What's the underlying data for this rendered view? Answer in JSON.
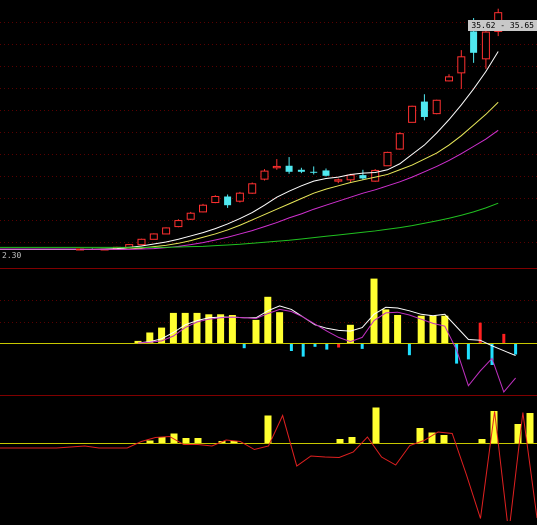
{
  "price_tag": "35.62 - 35.65",
  "low_label": "2.30",
  "colors": {
    "background": "#000000",
    "panel_border": "#800000",
    "grid_dot": "#5a0000",
    "up_candle": "#ff3030",
    "down_candle": "#50e8f0",
    "ma_short": "#ffffff",
    "ma_mid": "#e8e85a",
    "ma_long": "#d030d0",
    "ma_longest": "#20c020",
    "volume_yellow": "#ffff30",
    "volume_red": "#ff2020",
    "volume_cyan": "#20e0ff",
    "macd_line": "#ffffff",
    "signal_line": "#c030c0",
    "zero_line": "#c8c800",
    "indicator_red": "#e02020"
  },
  "chart_data": [
    {
      "type": "candlestick",
      "title": "",
      "candles": [
        {
          "o": 3.0,
          "h": 3.1,
          "l": 2.9,
          "c": 3.05,
          "dir": "up"
        },
        {
          "o": 3.05,
          "h": 3.15,
          "l": 2.95,
          "c": 3.0,
          "dir": "down"
        },
        {
          "o": 3.0,
          "h": 3.1,
          "l": 2.95,
          "c": 3.05,
          "dir": "up"
        },
        {
          "o": 3.1,
          "h": 3.4,
          "l": 3.05,
          "c": 3.3,
          "dir": "up"
        },
        {
          "o": 3.3,
          "h": 3.8,
          "l": 3.2,
          "c": 3.7,
          "dir": "up"
        },
        {
          "o": 3.7,
          "h": 4.6,
          "l": 3.7,
          "c": 4.5,
          "dir": "up"
        },
        {
          "o": 4.5,
          "h": 5.4,
          "l": 4.5,
          "c": 5.3,
          "dir": "up"
        },
        {
          "o": 5.3,
          "h": 6.3,
          "l": 5.3,
          "c": 6.2,
          "dir": "up"
        },
        {
          "o": 6.4,
          "h": 7.5,
          "l": 6.3,
          "c": 7.3,
          "dir": "up"
        },
        {
          "o": 7.5,
          "h": 8.6,
          "l": 7.4,
          "c": 8.4,
          "dir": "up"
        },
        {
          "o": 8.6,
          "h": 9.8,
          "l": 8.5,
          "c": 9.6,
          "dir": "up"
        },
        {
          "o": 10.0,
          "h": 11.1,
          "l": 9.9,
          "c": 10.9,
          "dir": "up"
        },
        {
          "o": 10.9,
          "h": 11.2,
          "l": 9.2,
          "c": 9.6,
          "dir": "down"
        },
        {
          "o": 10.2,
          "h": 11.6,
          "l": 10.0,
          "c": 11.4,
          "dir": "up"
        },
        {
          "o": 11.4,
          "h": 13.0,
          "l": 11.3,
          "c": 12.8,
          "dir": "up"
        },
        {
          "o": 13.5,
          "h": 15.0,
          "l": 13.3,
          "c": 14.7,
          "dir": "up"
        },
        {
          "o": 15.2,
          "h": 16.5,
          "l": 14.9,
          "c": 15.4,
          "dir": "up"
        },
        {
          "o": 15.5,
          "h": 16.8,
          "l": 14.3,
          "c": 14.6,
          "dir": "down"
        },
        {
          "o": 14.9,
          "h": 15.2,
          "l": 14.4,
          "c": 14.6,
          "dir": "down"
        },
        {
          "o": 14.6,
          "h": 15.4,
          "l": 14.2,
          "c": 14.6,
          "dir": "down"
        },
        {
          "o": 14.8,
          "h": 15.1,
          "l": 13.9,
          "c": 14.0,
          "dir": "down"
        },
        {
          "o": 13.2,
          "h": 13.6,
          "l": 12.9,
          "c": 13.4,
          "dir": "up"
        },
        {
          "o": 13.4,
          "h": 14.3,
          "l": 13.0,
          "c": 14.1,
          "dir": "up"
        },
        {
          "o": 14.1,
          "h": 14.9,
          "l": 13.4,
          "c": 13.6,
          "dir": "down"
        },
        {
          "o": 13.2,
          "h": 15.0,
          "l": 13.1,
          "c": 14.8,
          "dir": "up"
        },
        {
          "o": 15.5,
          "h": 17.6,
          "l": 15.5,
          "c": 17.5,
          "dir": "up"
        },
        {
          "o": 18.0,
          "h": 20.5,
          "l": 17.9,
          "c": 20.3,
          "dir": "up"
        },
        {
          "o": 22.0,
          "h": 24.5,
          "l": 22.0,
          "c": 24.4,
          "dir": "up"
        },
        {
          "o": 25.1,
          "h": 26.2,
          "l": 22.3,
          "c": 22.8,
          "dir": "down"
        },
        {
          "o": 23.3,
          "h": 25.4,
          "l": 23.2,
          "c": 25.3,
          "dir": "up"
        },
        {
          "o": 28.2,
          "h": 29.2,
          "l": 28.1,
          "c": 28.8,
          "dir": "up"
        },
        {
          "o": 29.4,
          "h": 32.8,
          "l": 27.0,
          "c": 31.8,
          "dir": "up"
        },
        {
          "o": 35.6,
          "h": 37.6,
          "l": 30.9,
          "c": 32.4,
          "dir": "down"
        },
        {
          "o": 31.5,
          "h": 35.8,
          "l": 30.0,
          "c": 35.5,
          "dir": "up"
        },
        {
          "o": 35.6,
          "h": 39.0,
          "l": 34.9,
          "c": 38.4,
          "dir": "up"
        }
      ],
      "moving_averages": [
        {
          "key": "ma_short",
          "values": [
            3.0,
            3.0,
            3.05,
            3.1,
            3.3,
            3.5,
            3.8,
            4.1,
            4.5,
            5.0,
            5.5,
            6.1,
            6.8,
            7.6,
            8.5,
            9.6,
            10.8,
            11.7,
            12.5,
            13.2,
            13.6,
            13.8,
            14.2,
            14.4,
            14.5,
            14.9,
            15.8,
            17.2,
            18.6,
            20.4,
            22.4,
            24.6,
            27.0,
            29.6,
            32.6
          ]
        },
        {
          "key": "ma_mid",
          "values": [
            3.0,
            3.0,
            3.0,
            3.0,
            3.05,
            3.2,
            3.4,
            3.6,
            3.9,
            4.3,
            4.8,
            5.3,
            5.9,
            6.6,
            7.4,
            8.2,
            9.0,
            9.8,
            10.6,
            11.4,
            12.0,
            12.5,
            13.0,
            13.4,
            13.8,
            14.2,
            14.9,
            15.6,
            16.5,
            17.4,
            18.6,
            20.0,
            21.6,
            23.2,
            25.0
          ]
        },
        {
          "key": "ma_long",
          "values": [
            3.0,
            3.0,
            3.0,
            3.0,
            3.0,
            3.05,
            3.1,
            3.25,
            3.45,
            3.7,
            4.0,
            4.4,
            4.8,
            5.3,
            5.8,
            6.4,
            7.0,
            7.7,
            8.3,
            9.0,
            9.6,
            10.2,
            10.8,
            11.4,
            11.9,
            12.5,
            13.1,
            13.8,
            14.6,
            15.4,
            16.3,
            17.3,
            18.4,
            19.5,
            20.8
          ]
        },
        {
          "key": "ma_longest",
          "values": [
            3.3,
            3.3,
            3.3,
            3.3,
            3.3,
            3.3,
            3.3,
            3.3,
            3.35,
            3.4,
            3.45,
            3.55,
            3.65,
            3.75,
            3.9,
            4.05,
            4.2,
            4.35,
            4.55,
            4.75,
            4.95,
            5.15,
            5.35,
            5.55,
            5.75,
            6.0,
            6.25,
            6.55,
            6.9,
            7.25,
            7.65,
            8.1,
            8.6,
            9.2,
            9.9
          ]
        }
      ]
    },
    {
      "type": "bar",
      "title": "",
      "series_meta": "indicator panel 1 (volume-style bars with MACD-like lines)",
      "bars": [
        {
          "v": 0.3,
          "c": "volume_yellow"
        },
        {
          "v": 1.5,
          "c": "volume_yellow"
        },
        {
          "v": 2.2,
          "c": "volume_yellow"
        },
        {
          "v": 4.3,
          "c": "volume_yellow"
        },
        {
          "v": 4.3,
          "c": "volume_yellow"
        },
        {
          "v": 4.3,
          "c": "volume_yellow"
        },
        {
          "v": 4.1,
          "c": "volume_yellow"
        },
        {
          "v": 4.1,
          "c": "volume_yellow"
        },
        {
          "v": 4.0,
          "c": "volume_yellow"
        },
        {
          "v": -0.6,
          "c": "volume_cyan"
        },
        {
          "v": 3.3,
          "c": "volume_yellow"
        },
        {
          "v": 6.6,
          "c": "volume_yellow"
        },
        {
          "v": 4.4,
          "c": "volume_yellow"
        },
        {
          "v": -1.0,
          "c": "volume_cyan"
        },
        {
          "v": -1.8,
          "c": "volume_cyan"
        },
        {
          "v": -0.4,
          "c": "volume_cyan"
        },
        {
          "v": -0.8,
          "c": "volume_cyan"
        },
        {
          "v": -0.5,
          "c": "volume_red"
        },
        {
          "v": 2.6,
          "c": "volume_yellow"
        },
        {
          "v": -0.7,
          "c": "volume_cyan"
        },
        {
          "v": 9.2,
          "c": "volume_yellow"
        },
        {
          "v": 4.8,
          "c": "volume_yellow"
        },
        {
          "v": 4.0,
          "c": "volume_yellow"
        },
        {
          "v": -1.6,
          "c": "volume_cyan"
        },
        {
          "v": 3.9,
          "c": "volume_yellow"
        },
        {
          "v": 3.9,
          "c": "volume_yellow"
        },
        {
          "v": 3.9,
          "c": "volume_yellow"
        },
        {
          "v": -2.8,
          "c": "volume_cyan"
        },
        {
          "v": -2.2,
          "c": "volume_cyan"
        },
        {
          "v": 2.9,
          "c": "volume_red"
        },
        {
          "v": -3.0,
          "c": "volume_cyan"
        },
        {
          "v": 1.3,
          "c": "volume_red"
        },
        {
          "v": -1.5,
          "c": "volume_cyan"
        }
      ],
      "lines": [
        {
          "key": "macd_line",
          "values": [
            0.0,
            0.2,
            0.6,
            1.5,
            2.6,
            3.2,
            3.6,
            3.7,
            3.7,
            3.6,
            3.6,
            4.6,
            5.3,
            4.8,
            3.7,
            2.6,
            2.1,
            1.8,
            1.7,
            2.2,
            4.1,
            5.1,
            5.0,
            4.6,
            4.1,
            3.9,
            4.1,
            2.3,
            0.5,
            0.4,
            -0.4,
            -1.1,
            -1.8
          ]
        },
        {
          "key": "signal_line",
          "values": [
            0.0,
            0.1,
            0.3,
            1.0,
            2.2,
            3.0,
            3.4,
            3.6,
            3.7,
            3.6,
            3.5,
            4.2,
            4.8,
            4.5,
            3.7,
            2.7,
            1.7,
            0.8,
            0.2,
            0.8,
            3.2,
            4.3,
            4.4,
            4.0,
            3.4,
            2.8,
            2.4,
            -1.0,
            -6.1,
            -4.0,
            -2.2,
            -7.0,
            -5.0
          ]
        }
      ]
    },
    {
      "type": "bar",
      "title": "",
      "series_meta": "indicator panel 2 (bars above zero with red oscillator line)",
      "bars": [
        {
          "v": 0.5
        },
        {
          "v": 1.2
        },
        {
          "v": 1.9
        },
        {
          "v": 1.0
        },
        {
          "v": 1.0
        },
        {
          "v": 0.4
        },
        {
          "v": 0.4
        },
        {
          "v": 5.5
        },
        {
          "v": 0.8
        },
        {
          "v": 1.2
        },
        {
          "v": 7.1
        },
        {
          "v": 3.0
        },
        {
          "v": 2.1
        },
        {
          "v": 1.6
        },
        {
          "v": 0.8
        },
        {
          "v": 6.4
        },
        {
          "v": 3.8
        },
        {
          "v": 6.0
        }
      ],
      "line": [
        -1.0,
        -1.0,
        -1.0,
        -1.0,
        -1.0,
        -0.8,
        -0.6,
        -1.0,
        -1.0,
        -1.0,
        0.3,
        1.1,
        1.3,
        -0.3,
        -0.3,
        -0.6,
        0.6,
        0.3,
        -1.3,
        -0.6,
        5.5,
        -4.6,
        -2.6,
        -2.8,
        -2.9,
        -1.8,
        1.2,
        -2.8,
        -4.4,
        -0.5,
        0.5,
        2.2,
        1.9,
        -6.3,
        -15.1,
        6.3,
        -18.1,
        6.1,
        -15.0
      ]
    }
  ]
}
